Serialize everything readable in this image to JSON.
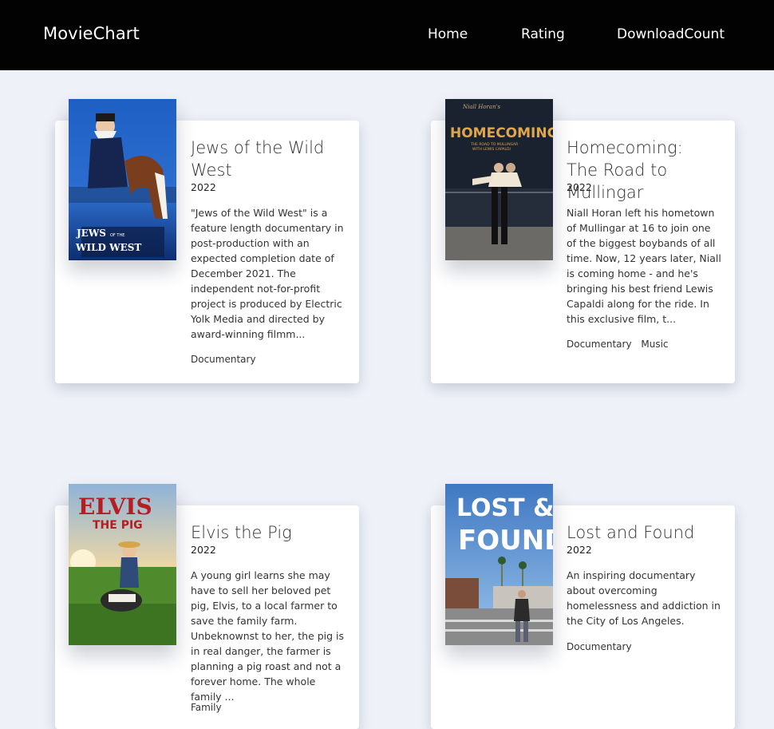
{
  "navbar": {
    "brand": "MovieChart",
    "links": [
      "Home",
      "Rating",
      "DownloadCount"
    ]
  },
  "movies": [
    {
      "title": "Jews of the Wild West",
      "year": "2022",
      "description": "\"Jews of the Wild West\" is a feature length documentary in post-production with an expected completion date of December 2021. The independent not-for-profit project is produced by Electric Yolk Media and directed by award-winning filmm...",
      "genres": [
        "Documentary"
      ],
      "poster_text": [
        "JEWS",
        "OF THE",
        "WILD WEST"
      ]
    },
    {
      "title": "Homecoming: The Road to Mullingar",
      "year": "2022",
      "description": "Niall Horan left his hometown of Mullingar at 16 to join one of the biggest boybands of all time. Now, 12 years later, Niall is coming home - and he's bringing his best friend Lewis Capaldi along for the ride. In this exclusive film, t...",
      "genres": [
        "Documentary",
        "Music"
      ],
      "poster_text": [
        "Niall Horan's",
        "HOMECOMING",
        "THE ROAD TO MULLINGAR",
        "WITH LEWIS CAPALDI"
      ]
    },
    {
      "title": "Elvis the Pig",
      "year": "2022",
      "description": "A young girl learns she may have to sell her beloved pet pig, Elvis, to a local farmer to save the family farm. Unbeknownst to her, the pig is in real danger, the farmer is planning a pig roast and not a forever home. The whole family ...",
      "genres": [
        "Family"
      ],
      "poster_text": [
        "ELVIS",
        "THE PIG"
      ]
    },
    {
      "title": "Lost and Found",
      "year": "2022",
      "description": "An inspiring documentary about overcoming homelessness and addiction in the City of Los Angeles.",
      "genres": [
        "Documentary"
      ],
      "poster_text": [
        "LOST &",
        "FOUND"
      ]
    }
  ]
}
